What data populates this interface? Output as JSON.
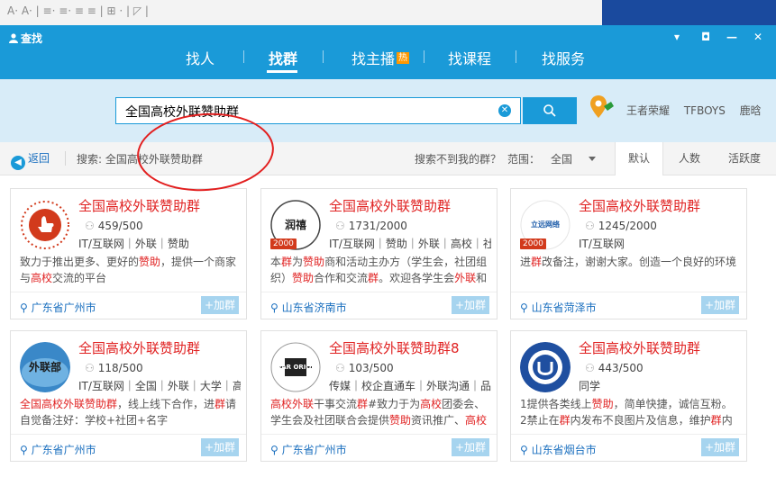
{
  "app": {
    "title": "查找"
  },
  "nav": {
    "tabs": [
      "找人",
      "找群",
      "找主播",
      "找课程",
      "找服务"
    ],
    "active_index": 1,
    "hot_badge": "热"
  },
  "search": {
    "value": "全国高校外联赞助群",
    "hot_keywords": [
      "王者荣耀",
      "TFBOYS",
      "鹿晗"
    ]
  },
  "filter": {
    "back_label": "返回",
    "breadcrumb": "搜索: 全国高校外联赞助群",
    "not_found_link": "搜索不到我的群？",
    "range_label": "范围：",
    "range_value": "全国",
    "sort_tabs": [
      "默认",
      "人数",
      "活跃度"
    ],
    "sort_active_index": 0
  },
  "join_label": "+加群",
  "cards": [
    {
      "name": "全国高校外联赞助群",
      "members": "459/500",
      "tags": "IT/互联网｜外联｜赞助",
      "desc": [
        [
          "致力于推出更多、更好的",
          ""
        ],
        [
          "赞助",
          "hl"
        ],
        [
          "，提供一个商家与",
          ""
        ],
        [
          "高校",
          "hl"
        ],
        [
          "交流的平台",
          ""
        ]
      ],
      "location": "广东省广州市",
      "badge": "",
      "avatar_kind": "thumb",
      "avatar_label": ""
    },
    {
      "name": "全国高校外联赞助群",
      "members": "1731/2000",
      "tags": "IT/互联网｜赞助｜外联｜高校｜社...",
      "desc": [
        [
          "本",
          ""
        ],
        [
          "群",
          "hl"
        ],
        [
          "为",
          ""
        ],
        [
          "赞助",
          "hl"
        ],
        [
          "商和活动主办方（学生会，社团组织）",
          ""
        ],
        [
          "赞助",
          "hl"
        ],
        [
          "合作和交流",
          ""
        ],
        [
          "群",
          "hl"
        ],
        [
          "。欢迎各学生会",
          ""
        ],
        [
          "外联",
          "hl"
        ],
        [
          "和社...",
          ""
        ]
      ],
      "location": "山东省济南市",
      "badge": "2000",
      "avatar_kind": "ink",
      "avatar_label": "润禧"
    },
    {
      "name": "全国高校外联赞助群",
      "members": "1245/2000",
      "tags": "IT/互联网",
      "desc": [
        [
          "进",
          ""
        ],
        [
          "群",
          "hl"
        ],
        [
          "改备注，谢谢大家。创造一个良好的环境",
          ""
        ]
      ],
      "location": "山东省菏泽市",
      "badge": "2000",
      "avatar_kind": "text",
      "avatar_label": "立远网络"
    },
    {
      "name": "全国高校外联赞助群",
      "members": "118/500",
      "tags": "IT/互联网｜全国｜外联｜大学｜高...",
      "desc": [
        [
          "全国高校外联赞助群",
          "hl"
        ],
        [
          "，线上线下合作，进",
          ""
        ],
        [
          "群",
          "hl"
        ],
        [
          "请自觉备注好：学校+社团+名字",
          ""
        ]
      ],
      "location": "广东省广州市",
      "badge": "",
      "avatar_kind": "sky",
      "avatar_label": "外联部"
    },
    {
      "name": "全国高校外联赞助群8",
      "members": "103/500",
      "tags": "传媒｜校企直通车｜外联沟通｜品...",
      "desc": [
        [
          "高校",
          "hl"
        ],
        [
          "外联",
          "hl"
        ],
        [
          "干事交流",
          ""
        ],
        [
          "群",
          "hl"
        ],
        [
          "#致力于为",
          ""
        ],
        [
          "高校",
          "hl"
        ],
        [
          "团委会、学生会及社团联合会提供",
          ""
        ],
        [
          "赞助",
          "hl"
        ],
        [
          "资讯推广、",
          ""
        ],
        [
          "高校",
          "hl"
        ],
        [
          "联谊对...",
          ""
        ]
      ],
      "location": "广东省广州市",
      "badge": "",
      "avatar_kind": "war",
      "avatar_label": "WAR ORION"
    },
    {
      "name": "全国高校外联赞助群",
      "members": "443/500",
      "tags": "同学",
      "desc": [
        [
          "1提供各类线上",
          ""
        ],
        [
          "赞助",
          "hl"
        ],
        [
          "，简单快捷，诚信互粉。 2禁止在",
          ""
        ],
        [
          "群",
          "hl"
        ],
        [
          "内发布不良图片及信息，维护",
          ""
        ],
        [
          "群",
          "hl"
        ],
        [
          "内健康 3...",
          ""
        ]
      ],
      "location": "山东省烟台市",
      "badge": "",
      "avatar_kind": "emblem",
      "avatar_label": ""
    }
  ],
  "colors": {
    "header": "#1a9ad8",
    "name_red": "#e02222",
    "link_blue": "#1a6fbf",
    "join_button": "#a6d4ef"
  }
}
